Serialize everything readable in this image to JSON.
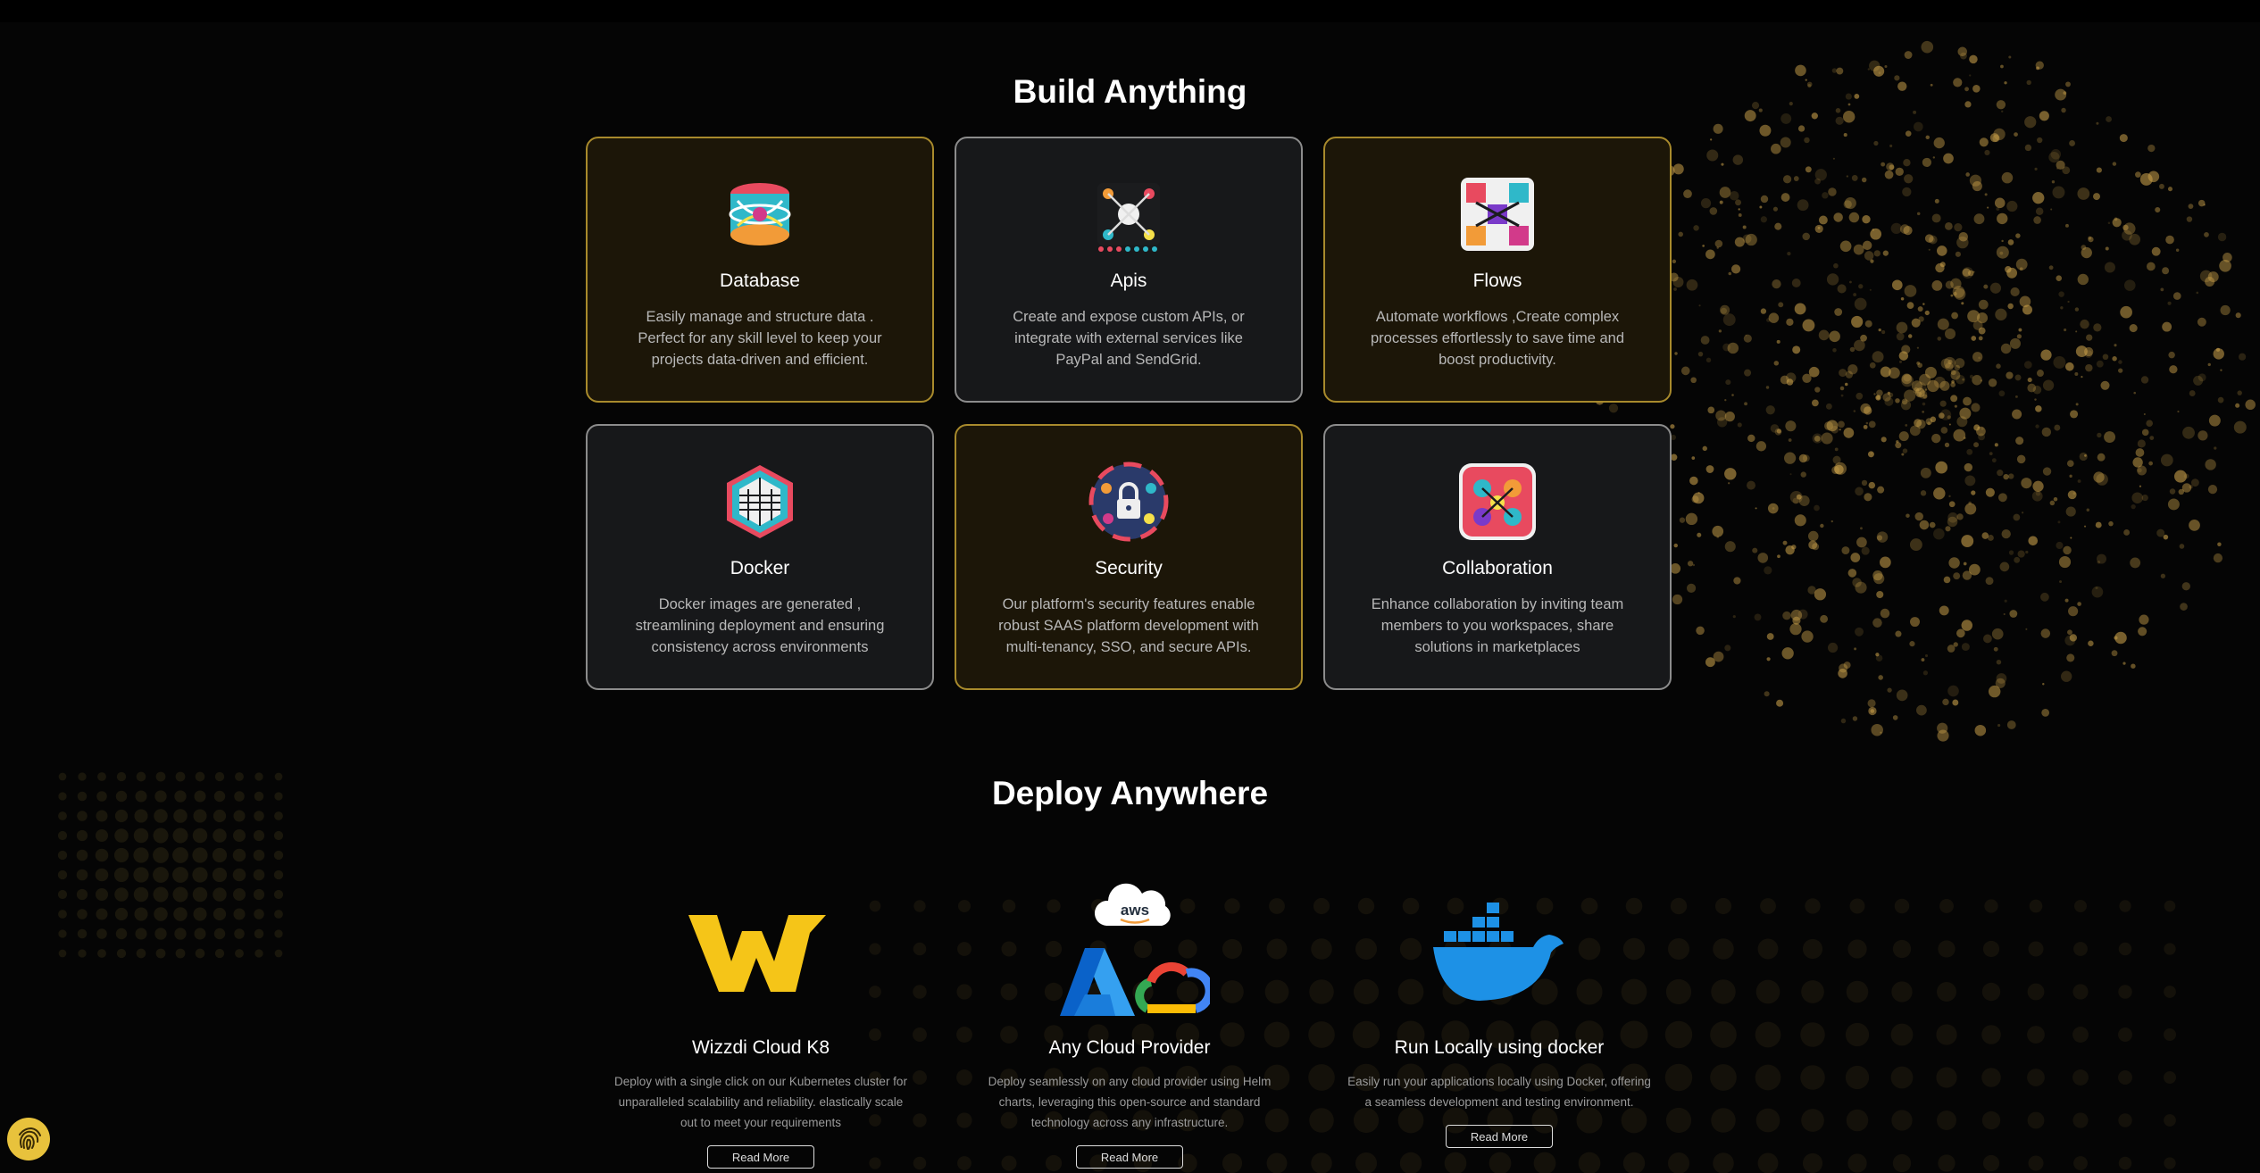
{
  "build": {
    "title": "Build Anything",
    "cards": [
      {
        "title": "Database",
        "desc": "Easily manage and structure data . Perfect for any skill level to keep your projects data-driven and efficient.",
        "icon": "database-icon"
      },
      {
        "title": "Apis",
        "desc": "Create and expose custom APIs, or integrate with external services like PayPal and SendGrid.",
        "icon": "api-icon"
      },
      {
        "title": "Flows",
        "desc": "Automate workflows ,Create complex processes effortlessly to save time and boost productivity.",
        "icon": "flows-icon"
      },
      {
        "title": "Docker",
        "desc": "Docker images are generated , streamlining deployment and ensuring consistency across environments",
        "icon": "docker-cube-icon"
      },
      {
        "title": "Security",
        "desc": "Our platform's security features enable robust SAAS platform development with multi-tenancy, SSO, and secure APIs.",
        "icon": "security-lock-icon"
      },
      {
        "title": "Collaboration",
        "desc": "Enhance collaboration by inviting team members to you workspaces, share solutions in marketplaces",
        "icon": "collaboration-icon"
      }
    ]
  },
  "deploy": {
    "title": "Deploy Anywhere",
    "items": [
      {
        "title": "Wizzdi Cloud K8",
        "desc": "Deploy with a single click on our Kubernetes cluster for unparalleled scalability and reliability. elastically scale out to meet your requirements",
        "button": "Read More"
      },
      {
        "title": "Any Cloud Provider",
        "desc": "Deploy seamlessly on any cloud provider using Helm charts, leveraging this open-source and standard technology across any infrastructure.",
        "button": "Read More"
      },
      {
        "title": "Run Locally using docker",
        "desc": "Easily run your applications locally using Docker, offering a seamless development and testing environment.",
        "button": "Read More"
      }
    ],
    "aws_label": "aws"
  },
  "colors": {
    "gold_border": "#a88a2c",
    "accent": "#f5c518",
    "docker_blue": "#1d91e6"
  }
}
